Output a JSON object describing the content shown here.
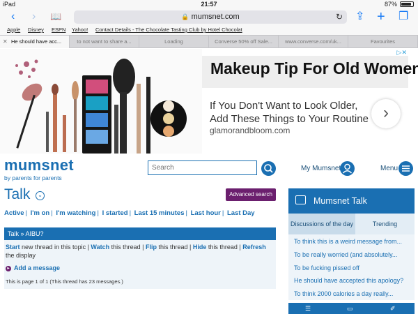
{
  "status_bar": {
    "device": "iPad",
    "time": "21:57",
    "battery": "87%",
    "battery_level": 0.87
  },
  "browser": {
    "url": "mumsnet.com",
    "bookmarks": [
      "Apple",
      "Disney",
      "ESPN",
      "Yahoo!",
      "Contact Details - The Chocolate Tasting Club by Hotel Chocolat"
    ],
    "tabs": [
      "He should have acc...",
      "to not want to share a...",
      "Loading",
      "Converse 50% off Sale...",
      "www.converse.com/uk...",
      "Favourites"
    ]
  },
  "ad": {
    "title": "Makeup Tip For Old Women",
    "body": "If You Don't Want to Look Older, Add These Things to Your Routine",
    "domain": "glamorandbloom.com"
  },
  "header": {
    "logo": "mumsnet",
    "tagline": "by parents for parents",
    "search_placeholder": "Search",
    "my_mumsnet": "My Mumsnet",
    "menu": "Menu"
  },
  "talk": {
    "title": "Talk",
    "advanced_search": "Advanced search",
    "filters": [
      "Active",
      "I'm on",
      "I'm watching",
      "I started",
      "Last 15 minutes",
      "Last hour",
      "Last Day"
    ]
  },
  "thread": {
    "breadcrumb": "Talk » AIBU?",
    "start": "Start",
    "start_text": " new thread in this topic | ",
    "watch": "Watch",
    "watch_text": " this thread | ",
    "flip": "Flip",
    "flip_text": " this thread | ",
    "hide": "Hide",
    "hide_text": " this thread | ",
    "refresh": "Refresh",
    "refresh_text": " the display",
    "add_message": "Add a message",
    "page_info": "This is page 1 of 1 (This thread has 23 messages.)"
  },
  "sidebar": {
    "title": "Mumsnet Talk",
    "tab_discussions": "Discussions of the day",
    "tab_trending": "Trending",
    "items": [
      "To think this is a weird message from...",
      "To be really worried (and absolutely...",
      "To be fucking pissed off",
      "He should have accepted this apology?",
      "To think 2000 calories a day really..."
    ]
  },
  "colors": {
    "brand_blue": "#1a6fb2",
    "purple": "#6b1f6e",
    "ios_blue": "#1a7cf5"
  }
}
